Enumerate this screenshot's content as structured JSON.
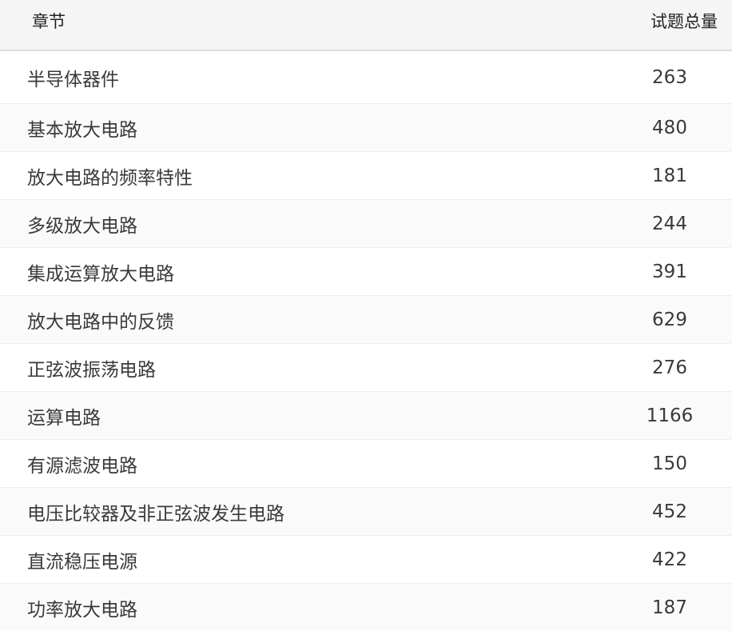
{
  "table": {
    "headers": {
      "chapter": "章节",
      "count": "试题总量"
    },
    "rows": [
      {
        "chapter": "半导体器件",
        "count": "263"
      },
      {
        "chapter": "基本放大电路",
        "count": "480"
      },
      {
        "chapter": "放大电路的频率特性",
        "count": "181"
      },
      {
        "chapter": "多级放大电路",
        "count": "244"
      },
      {
        "chapter": "集成运算放大电路",
        "count": "391"
      },
      {
        "chapter": "放大电路中的反馈",
        "count": "629"
      },
      {
        "chapter": "正弦波振荡电路",
        "count": "276"
      },
      {
        "chapter": "运算电路",
        "count": "1166"
      },
      {
        "chapter": "有源滤波电路",
        "count": "150"
      },
      {
        "chapter": "电压比较器及非正弦波发生电路",
        "count": "452"
      },
      {
        "chapter": "直流稳压电源",
        "count": "422"
      },
      {
        "chapter": "功率放大电路",
        "count": "187"
      }
    ]
  }
}
